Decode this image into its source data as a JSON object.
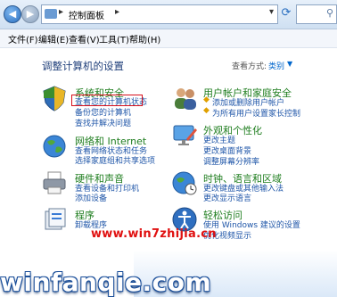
{
  "address": {
    "breadcrumb": "控制面板",
    "back_icon": "back-arrow-icon",
    "forward_icon": "forward-arrow-icon"
  },
  "menu": [
    "文件(F)",
    "编辑(E)",
    "查看(V)",
    "工具(T)",
    "帮助(H)"
  ],
  "main": {
    "heading": "调整计算机的设置",
    "view_by_label": "查看方式:",
    "view_by_value": "类别"
  },
  "categories": {
    "system_security": {
      "title": "系统和安全",
      "links": [
        "查看您的计算机状态",
        "备份您的计算机",
        "查找并解决问题"
      ]
    },
    "network": {
      "title": "网络和 Internet",
      "links": [
        "查看网络状态和任务",
        "选择家庭组和共享选项"
      ]
    },
    "hardware": {
      "title": "硬件和声音",
      "links": [
        "查看设备和打印机",
        "添加设备"
      ]
    },
    "programs": {
      "title": "程序",
      "links": [
        "卸载程序"
      ]
    },
    "user_accounts": {
      "title": "用户帐户和家庭安全",
      "links": [
        "添加或删除用户帐户",
        "为所有用户设置家长控制"
      ]
    },
    "appearance": {
      "title": "外观和个性化",
      "links": [
        "更改主题",
        "更改桌面背景",
        "调整屏幕分辨率"
      ]
    },
    "clock": {
      "title": "时钟、语言和区域",
      "links": [
        "更改键盘或其他输入法",
        "更改显示语言"
      ]
    },
    "ease": {
      "title": "轻松访问",
      "links": [
        "使用 Windows 建议的设置",
        "优化视频显示"
      ]
    }
  },
  "watermarks": {
    "site_url": "www.win7zhijia.cn",
    "brand": "winfanqie.com"
  },
  "colors": {
    "category_title": "#1e7d1e",
    "link": "#1f56a8",
    "heading": "#1f3f7a",
    "highlight_box": "#d8101c"
  }
}
